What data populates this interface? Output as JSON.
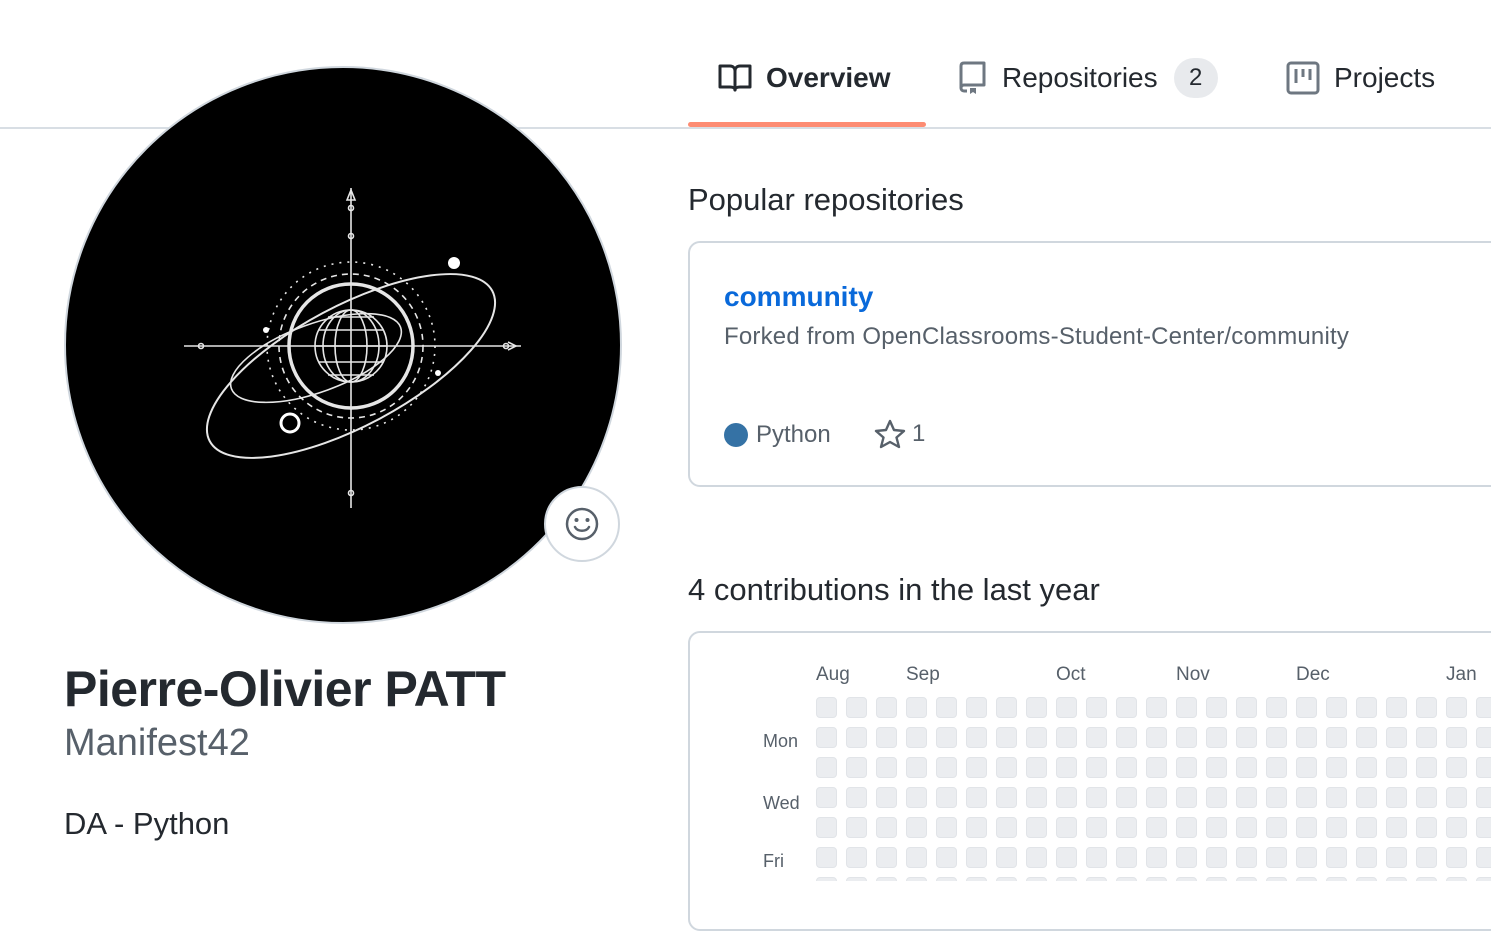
{
  "tabs": {
    "overview": "Overview",
    "repositories": "Repositories",
    "repositories_count": "2",
    "projects": "Projects",
    "active": "Overview"
  },
  "profile": {
    "full_name": "Pierre-Olivier PATT",
    "username": "Manifest42",
    "bio": "DA - Python"
  },
  "popular": {
    "title": "Popular repositories",
    "repos": [
      {
        "name": "community",
        "forked_from": "Forked from OpenClassrooms-Student-Center/community",
        "language": "Python",
        "language_color": "#3572a5",
        "stars": "1"
      }
    ]
  },
  "contributions": {
    "title": "4 contributions in the last year",
    "months": [
      "Aug",
      "Sep",
      "Oct",
      "Nov",
      "Dec",
      "Jan"
    ],
    "days": [
      "Mon",
      "Wed",
      "Fri"
    ]
  },
  "colors": {
    "accent_underline": "#fd8c73",
    "link": "#0969da",
    "empty_cell": "#ebedf0"
  },
  "icons": {
    "overview": "book-icon",
    "repositories": "repo-icon",
    "projects": "project-icon",
    "status": "smiley-icon",
    "star": "star-icon"
  }
}
